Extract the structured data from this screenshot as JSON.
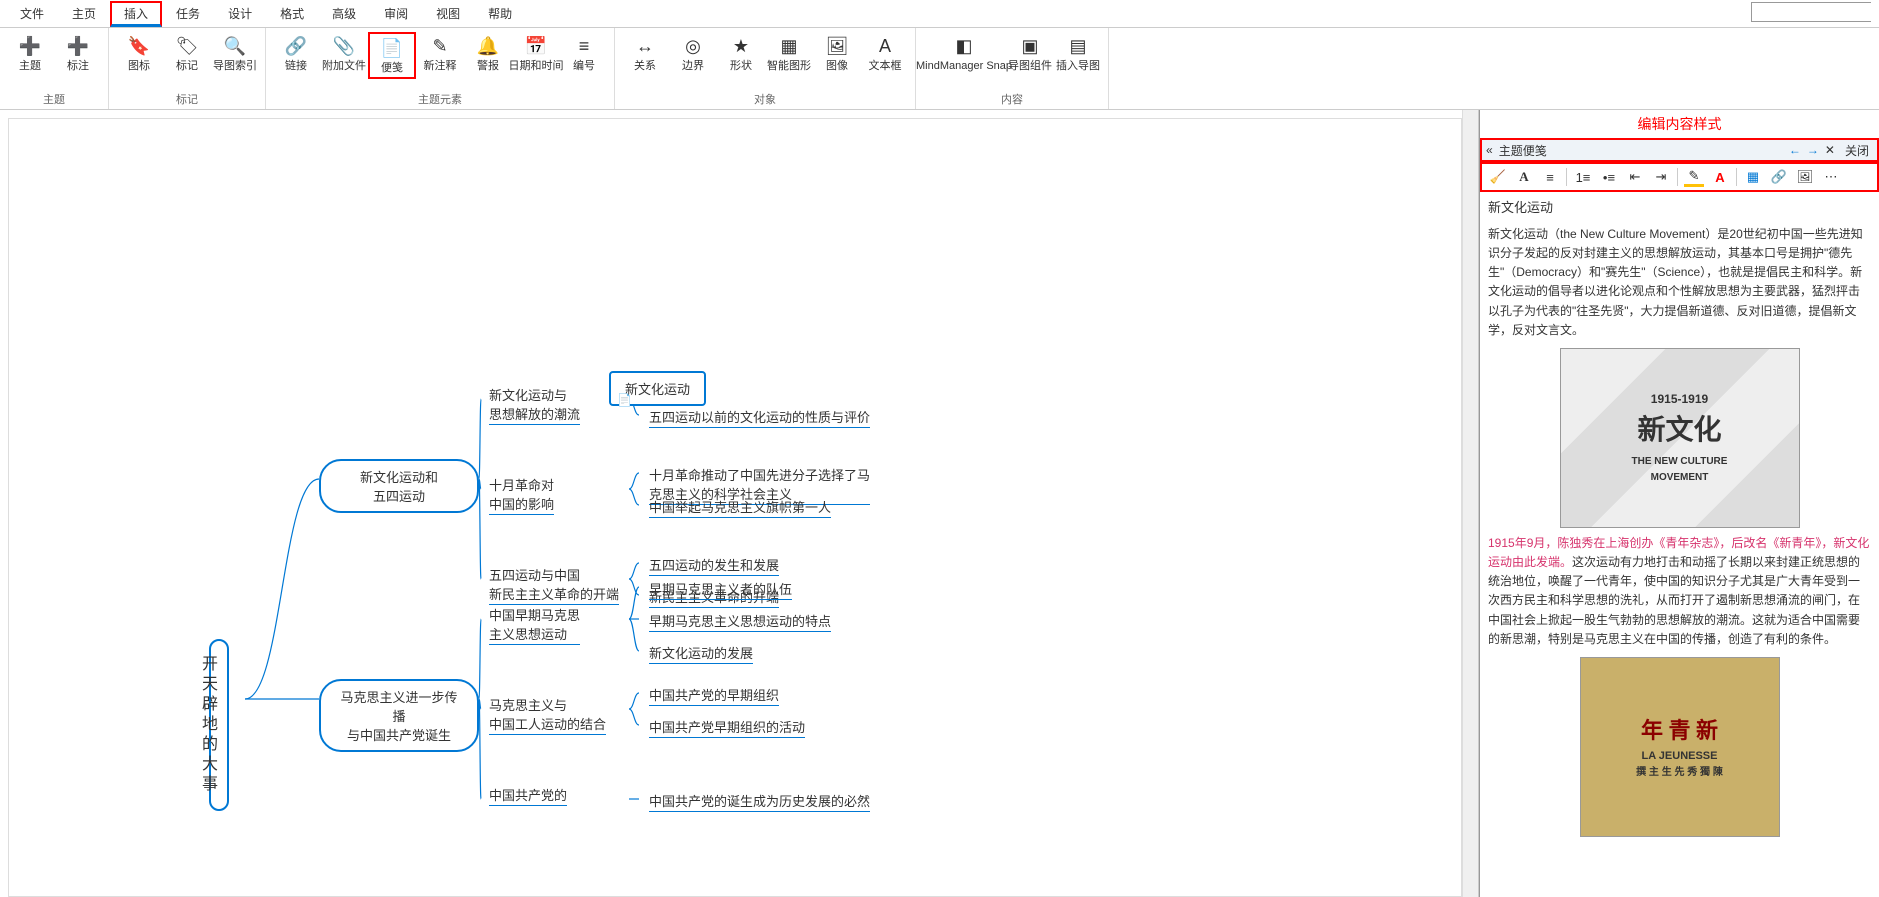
{
  "menu": [
    "文件",
    "主页",
    "插入",
    "任务",
    "设计",
    "格式",
    "高级",
    "审阅",
    "视图",
    "帮助"
  ],
  "menu_active_index": 2,
  "ribbon": {
    "groups": [
      {
        "label": "主题",
        "buttons": [
          {
            "name": "主题",
            "icon": "➕",
            "color": "#2e8b57"
          },
          {
            "name": "标注",
            "icon": "➕",
            "color": "#2e8b57"
          }
        ]
      },
      {
        "label": "标记",
        "buttons": [
          {
            "name": "图标",
            "icon": "🔖"
          },
          {
            "name": "标记",
            "icon": "🏷"
          },
          {
            "name": "导图索引",
            "icon": "🔍"
          }
        ]
      },
      {
        "label": "主题元素",
        "buttons": [
          {
            "name": "链接",
            "icon": "🔗"
          },
          {
            "name": "附加文件",
            "icon": "📎"
          },
          {
            "name": "便笺",
            "icon": "📄",
            "highlight": true
          },
          {
            "name": "新注释",
            "icon": "✎"
          },
          {
            "name": "警报",
            "icon": "🔔"
          },
          {
            "name": "日期和时间",
            "icon": "📅"
          },
          {
            "name": "编号",
            "icon": "≡"
          }
        ]
      },
      {
        "label": "对象",
        "buttons": [
          {
            "name": "关系",
            "icon": "↔"
          },
          {
            "name": "边界",
            "icon": "◎"
          },
          {
            "name": "形状",
            "icon": "★"
          },
          {
            "name": "智能图形",
            "icon": "▦"
          },
          {
            "name": "图像",
            "icon": "🖼"
          },
          {
            "name": "文本框",
            "icon": "A"
          }
        ]
      },
      {
        "label": "内容",
        "buttons": [
          {
            "name": "MindManager Snap",
            "icon": "◧",
            "wide": true
          },
          {
            "name": "导图组件",
            "icon": "▣"
          },
          {
            "name": "插入导图",
            "icon": "▤"
          }
        ]
      }
    ]
  },
  "search_placeholder": "",
  "mindmap": {
    "root": "开天辟地的大事",
    "hubs": [
      {
        "label": "新文化运动和\n五四运动",
        "children": [
          {
            "label": "新文化运动与\n思想解放的潮流",
            "leaves": [
              "新文化运动",
              "五四运动以前的文化运动的性质与评价"
            ],
            "selected_leaf": 0
          },
          {
            "label": "十月革命对\n中国的影响",
            "leaves": [
              "十月革命推动了中国先进分子选择了马\n克思主义的科学社会主义",
              "中国举起马克思主义旗帜第一人"
            ]
          },
          {
            "label": "五四运动与中国\n新民主主义革命的开端",
            "leaves": [
              "五四运动的发生和发展",
              "新民主主义革命的开端"
            ]
          }
        ]
      },
      {
        "label": "马克思主义进一步传播\n与中国共产党诞生",
        "children": [
          {
            "label": "中国早期马克思\n主义思想运动",
            "leaves": [
              "早期马克思主义者的队伍",
              "早期马克思主义思想运动的特点",
              "新文化运动的发展"
            ]
          },
          {
            "label": "马克思主义与\n中国工人运动的结合",
            "leaves": [
              "中国共产党的早期组织",
              "中国共产党早期组织的活动"
            ]
          },
          {
            "label": "中国共产党的",
            "leaves": [
              "中国共产党的诞生成为历史发展的必然"
            ]
          }
        ]
      }
    ]
  },
  "panel": {
    "annot": "编辑内容样式",
    "title": "主题便笺",
    "close": "关闭",
    "note_title": "新文化运动",
    "para1": "新文化运动（the New Culture Movement）是20世纪初中国一些先进知识分子发起的反对封建主义的思想解放运动，其基本口号是拥护\"德先生\"（Democracy）和\"赛先生\"（Science），也就是提倡民主和科学。新文化运动的倡导者以进化论观点和个性解放思想为主要武器，猛烈抨击以孔子为代表的\"往圣先贤\"，大力提倡新道德、反对旧道德，提倡新文学，反对文言文。",
    "img1": {
      "years": "1915-1919",
      "zh": "新文化",
      "en1": "THE NEW CULTURE",
      "en2": "MOVEMENT"
    },
    "para2_red": "1915年9月，陈独秀在上海创办《青年杂志》，后改名《新青年》，新文化运动由此发端。",
    "para2_rest": "这次运动有力地打击和动摇了长期以来封建正统思想的统治地位，唤醒了一代青年，使中国的知识分子尤其是广大青年受到一次西方民主和科学思想的洗礼，从而打开了遏制新思想涌流的闸门，在中国社会上掀起一股生气勃勃的思想解放的潮流。这就为适合中国需要的新思潮，特别是马克思主义在中国的传播，创造了有利的条件。",
    "img2": {
      "line1": "年 青 新",
      "line2": "LA JEUNESSE",
      "line3": "撰 主 生 先 秀 獨 陳"
    }
  }
}
